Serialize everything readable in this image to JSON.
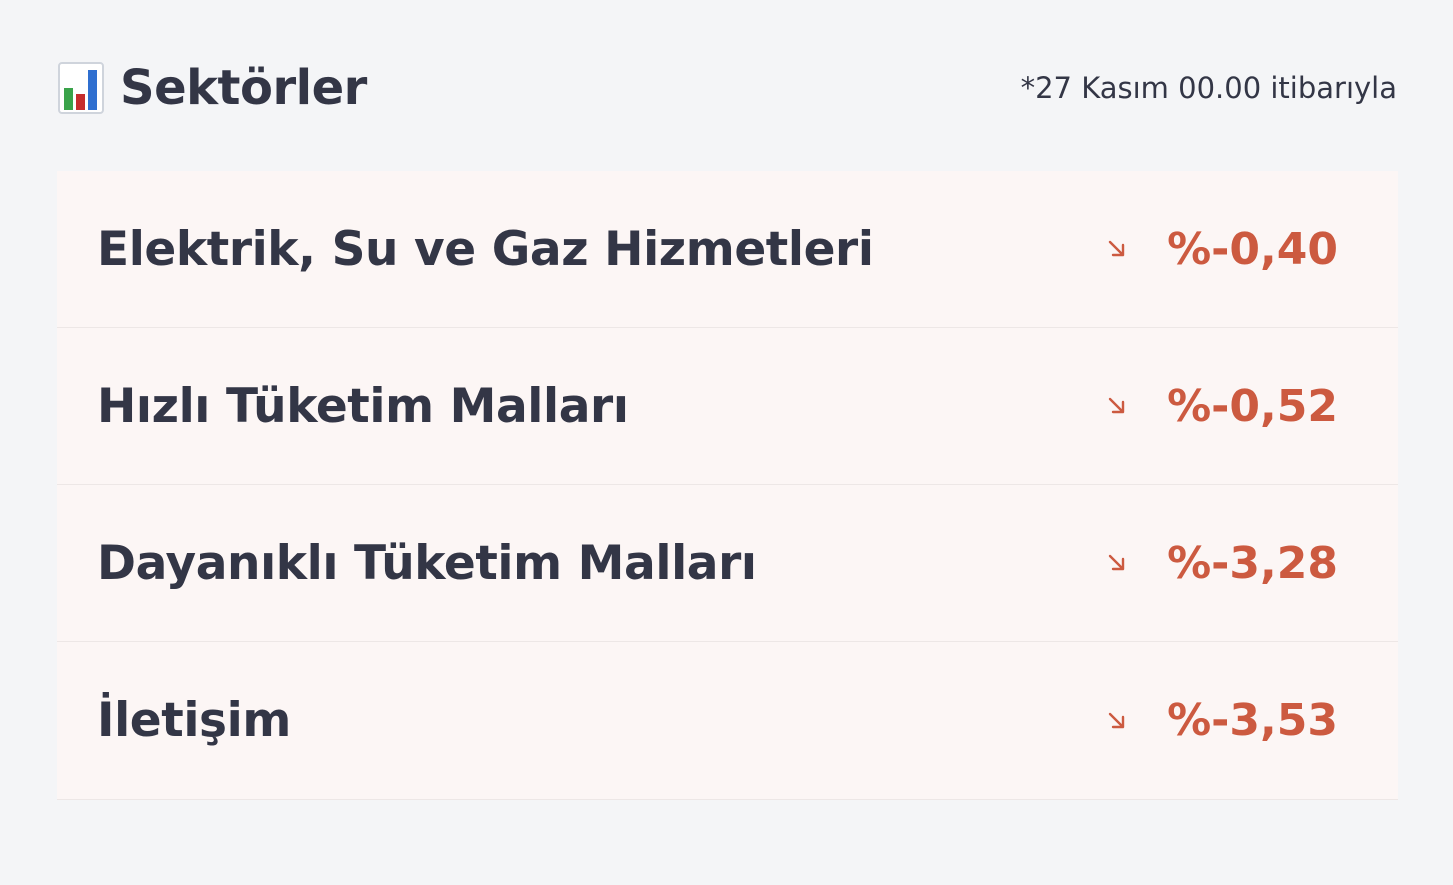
{
  "header": {
    "title": "Sektörler",
    "as_of": "*27 Kasım 00.00 itibarıyla",
    "icon": "bar-chart-icon"
  },
  "colors": {
    "negative": "#cc5a40",
    "text": "#333646",
    "row_background": "#fcf6f5",
    "page_background": "#f4f5f7"
  },
  "sectors": [
    {
      "name": "Elektrik, Su ve Gaz Hizmetleri",
      "change": "%-0,40",
      "trend_icon": "arrow-down-right-icon"
    },
    {
      "name": "Hızlı Tüketim Malları",
      "change": "%-0,52",
      "trend_icon": "arrow-down-right-icon"
    },
    {
      "name": "Dayanıklı Tüketim Malları",
      "change": "%-3,28",
      "trend_icon": "arrow-down-right-icon"
    },
    {
      "name": "İletişim",
      "change": "%-3,53",
      "trend_icon": "arrow-down-right-icon"
    }
  ]
}
